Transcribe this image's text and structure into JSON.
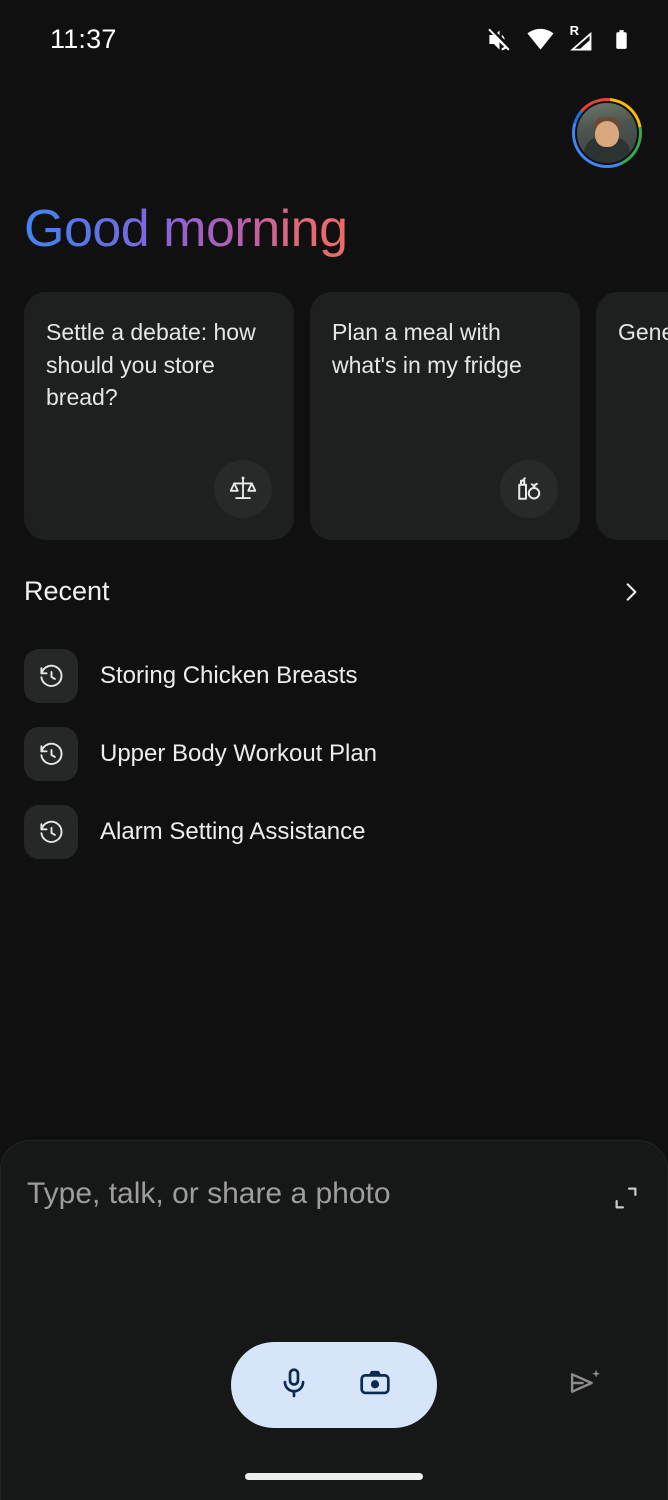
{
  "status_bar": {
    "time": "11:37",
    "icons": [
      "volume-off-icon",
      "wifi-icon",
      "cellular-roaming-icon",
      "battery-icon"
    ],
    "roaming_label": "R"
  },
  "account": {
    "avatar_name": "user-avatar"
  },
  "greeting": {
    "text": "Good morning",
    "gradient_start": "#4285f4",
    "gradient_mid": "#9a5fc4",
    "gradient_end": "#ec6b63"
  },
  "suggestion_cards": [
    {
      "text": "Settle a debate: how should you store bread?",
      "icon": "scales-balance-icon"
    },
    {
      "text": "Plan a meal with what's in my fridge",
      "icon": "grocery-icon"
    },
    {
      "text": "Gene water",
      "icon": "water-icon"
    }
  ],
  "recent": {
    "title": "Recent",
    "chevron": "chevron-right-icon",
    "items": [
      {
        "label": "Storing Chicken Breasts",
        "icon": "history-icon"
      },
      {
        "label": "Upper Body Workout Plan",
        "icon": "history-icon"
      },
      {
        "label": "Alarm Setting Assistance",
        "icon": "history-icon"
      }
    ]
  },
  "composer": {
    "placeholder": "Type, talk, or share a photo",
    "value": "",
    "expand_icon": "expand-icon",
    "mic_icon": "microphone-icon",
    "camera_icon": "camera-icon",
    "send_icon": "send-sparkle-icon",
    "pill_color": "#d7e5fb",
    "pill_icon_color": "#0b2a52"
  },
  "system_nav": {
    "handle": "home-gesture-handle"
  }
}
